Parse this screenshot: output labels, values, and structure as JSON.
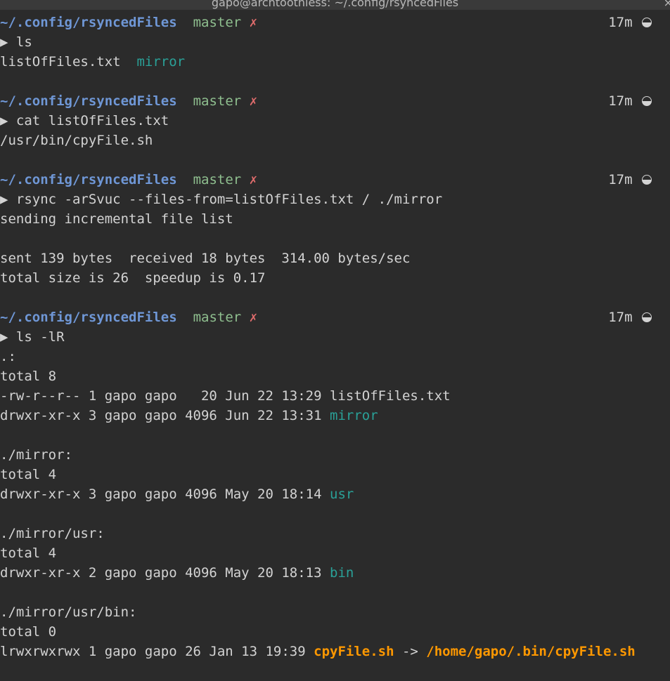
{
  "window": {
    "title": "gapo@archtoothless: ~/.config/rsyncedFiles",
    "close_glyph": "×"
  },
  "prompt": {
    "cwd": "~/.config/rsyncedFiles",
    "branch": "master",
    "dirty_mark": "✗",
    "elapsed": "17m",
    "arrow": "▶"
  },
  "blocks": [
    {
      "command": "ls",
      "output": [
        {
          "segments": [
            {
              "text": "listOfFiles.txt  ",
              "style": "plain"
            },
            {
              "text": "mirror",
              "style": "dir"
            }
          ]
        }
      ]
    },
    {
      "command": "cat listOfFiles.txt",
      "output": [
        {
          "segments": [
            {
              "text": "/usr/bin/cpyFile.sh",
              "style": "plain"
            }
          ]
        }
      ]
    },
    {
      "command": "rsync -arSvuc --files-from=listOfFiles.txt / ./mirror",
      "output": [
        {
          "segments": [
            {
              "text": "sending incremental file list",
              "style": "plain"
            }
          ]
        },
        {
          "segments": []
        },
        {
          "segments": [
            {
              "text": "sent 139 bytes  received 18 bytes  314.00 bytes/sec",
              "style": "plain"
            }
          ]
        },
        {
          "segments": [
            {
              "text": "total size is 26  speedup is 0.17",
              "style": "plain"
            }
          ]
        }
      ]
    },
    {
      "command": "ls -lR",
      "output": [
        {
          "segments": [
            {
              "text": ".:",
              "style": "plain"
            }
          ]
        },
        {
          "segments": [
            {
              "text": "total 8",
              "style": "plain"
            }
          ]
        },
        {
          "segments": [
            {
              "text": "-rw-r--r-- 1 gapo gapo   20 Jun 22 13:29 listOfFiles.txt",
              "style": "plain"
            }
          ]
        },
        {
          "segments": [
            {
              "text": "drwxr-xr-x 3 gapo gapo 4096 Jun 22 13:31 ",
              "style": "plain"
            },
            {
              "text": "mirror",
              "style": "dir"
            }
          ]
        },
        {
          "segments": []
        },
        {
          "segments": [
            {
              "text": "./mirror:",
              "style": "plain"
            }
          ]
        },
        {
          "segments": [
            {
              "text": "total 4",
              "style": "plain"
            }
          ]
        },
        {
          "segments": [
            {
              "text": "drwxr-xr-x 3 gapo gapo 4096 May 20 18:14 ",
              "style": "plain"
            },
            {
              "text": "usr",
              "style": "dir"
            }
          ]
        },
        {
          "segments": []
        },
        {
          "segments": [
            {
              "text": "./mirror/usr:",
              "style": "plain"
            }
          ]
        },
        {
          "segments": [
            {
              "text": "total 4",
              "style": "plain"
            }
          ]
        },
        {
          "segments": [
            {
              "text": "drwxr-xr-x 2 gapo gapo 4096 May 20 18:13 ",
              "style": "plain"
            },
            {
              "text": "bin",
              "style": "dir"
            }
          ]
        },
        {
          "segments": []
        },
        {
          "segments": [
            {
              "text": "./mirror/usr/bin:",
              "style": "plain"
            }
          ]
        },
        {
          "segments": [
            {
              "text": "total 0",
              "style": "plain"
            }
          ]
        },
        {
          "segments": [
            {
              "text": "lrwxrwxrwx 1 gapo gapo 26 Jan 13 19:39 ",
              "style": "plain"
            },
            {
              "text": "cpyFile.sh",
              "style": "link"
            },
            {
              "text": " -> ",
              "style": "plain"
            },
            {
              "text": "/home/gapo/.bin/cpyFile.sh",
              "style": "link"
            }
          ]
        }
      ]
    }
  ],
  "colors": {
    "background": "#2b2b2b",
    "foreground": "#d3d3d3",
    "cwd": "#6f97d6",
    "branch": "#8fbf8f",
    "dirty": "#e06c6c",
    "directory": "#2aa198",
    "symlink": "#ff9800"
  },
  "icons": {
    "elapsed_indicator": "clock-icon",
    "close": "close-icon"
  }
}
